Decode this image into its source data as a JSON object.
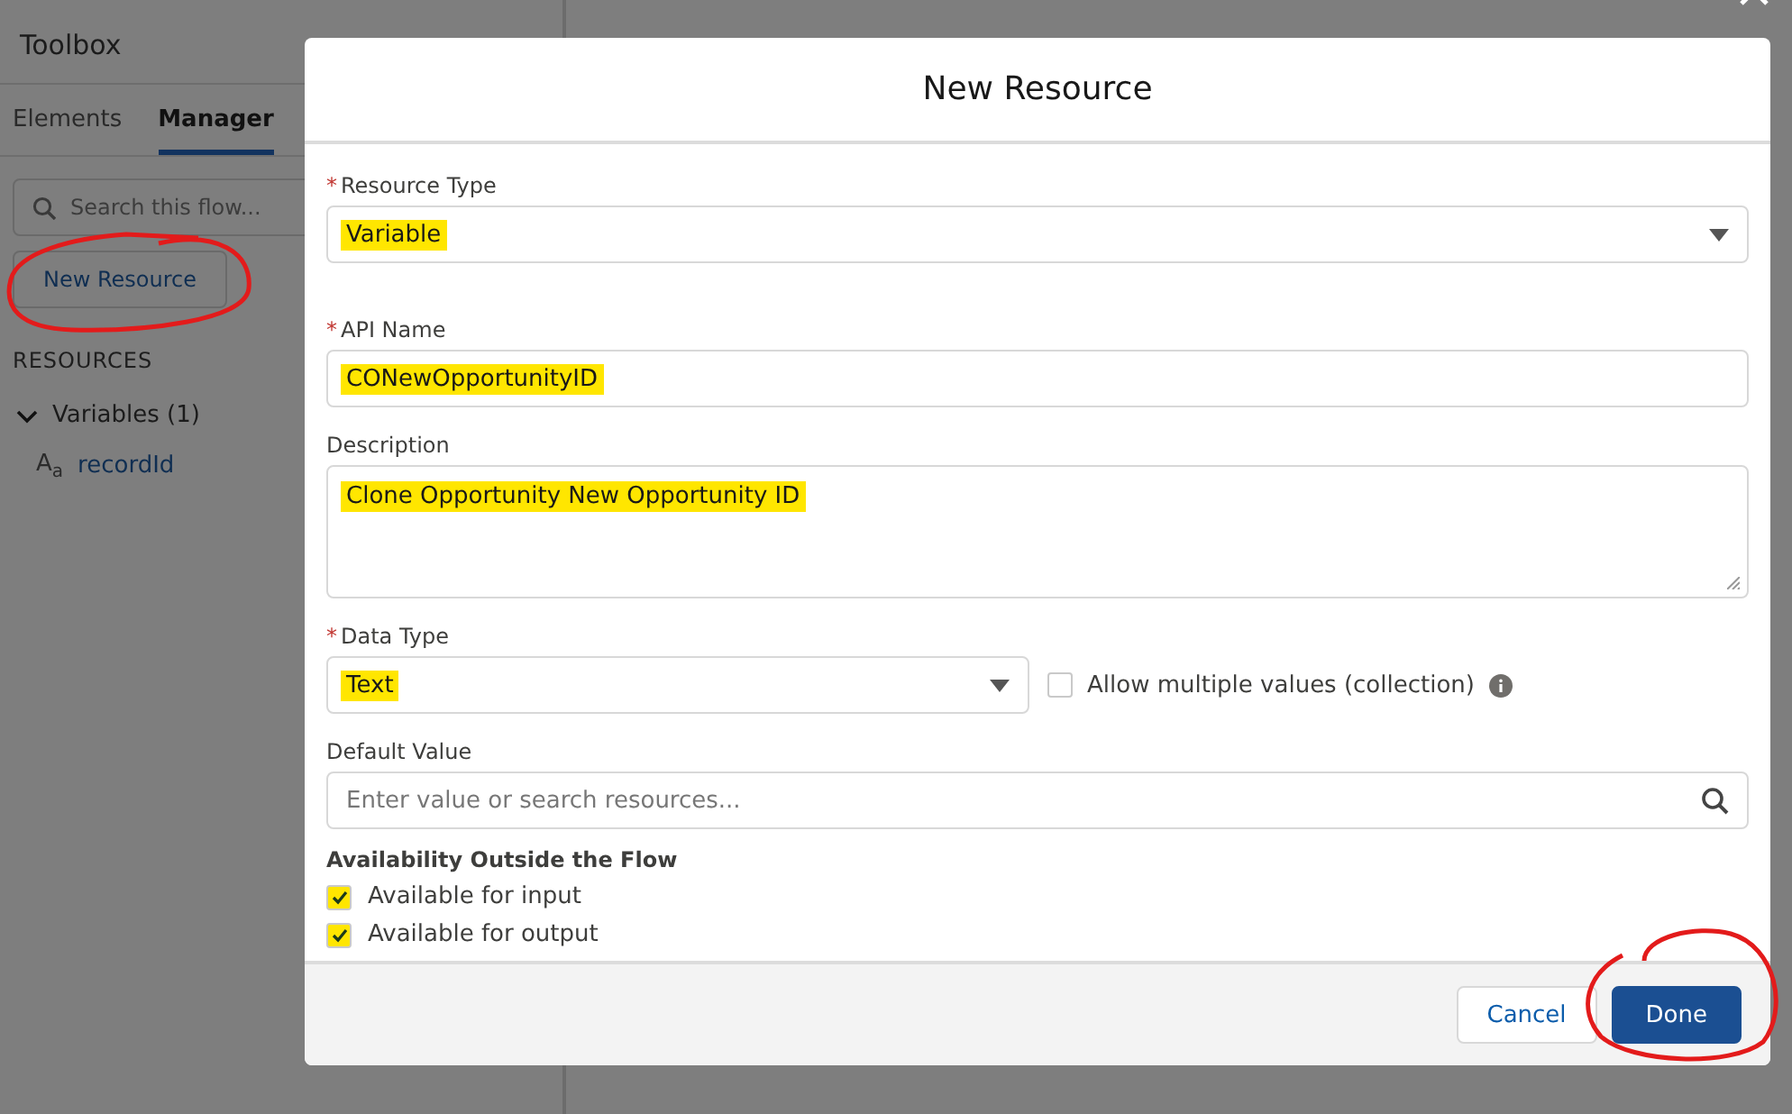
{
  "toolbox": {
    "title": "Toolbox",
    "tabs": [
      {
        "label": "Elements",
        "selected": false
      },
      {
        "label": "Manager",
        "selected": true
      }
    ],
    "search": {
      "placeholder": "Search this flow..."
    },
    "new_button": "New Resource",
    "section": "RESOURCES",
    "tree": [
      {
        "label": "Variables (1)",
        "expanded": true,
        "children": [
          {
            "label": "recordId",
            "icon": "A$_{a}$"
          }
        ]
      }
    ]
  },
  "modal": {
    "title": "New Resource",
    "fields": [
      {
        "kind": "select",
        "required_mark": "*",
        "label": "Resource Type",
        "value": "Variable",
        "highlighted": true
      },
      {
        "kind": "text",
        "required_mark": "*",
        "label": "API Name",
        "value": "CONewOpportunityID",
        "highlighted": true
      },
      {
        "kind": "textarea",
        "label": "Description",
        "value": "Clone Opportunity New Opportunity ID",
        "highlighted": true
      },
      {
        "kind": "select",
        "required_mark": "*",
        "label": "Data Type",
        "value": "Text",
        "highlighted": true,
        "checkbox": {
          "label": "Allow multiple values (collection)",
          "checked": false
        }
      },
      {
        "kind": "search",
        "label": "Default Value",
        "placeholder": "Enter value or search resources..."
      }
    ],
    "availability": {
      "heading": "Availability Outside the Flow",
      "options": [
        {
          "label": "Available for input",
          "checked": true,
          "highlighted": true
        },
        {
          "label": "Available for output",
          "checked": true,
          "highlighted": true
        }
      ]
    },
    "buttons": [
      {
        "label": "Cancel",
        "kind": "neutral"
      },
      {
        "label": "Done",
        "kind": "brand"
      }
    ]
  }
}
